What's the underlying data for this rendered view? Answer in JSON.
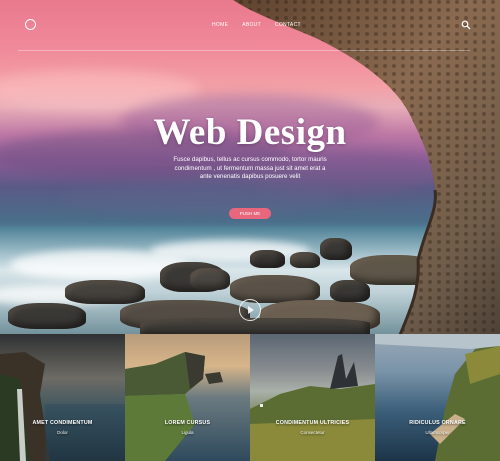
{
  "header": {
    "logo_icon": "circle-logo-icon",
    "nav": [
      {
        "label": "HOME"
      },
      {
        "label": "ABOUT"
      },
      {
        "label": "CONTACT"
      }
    ],
    "search_icon": "search-icon"
  },
  "hero": {
    "title": "Web Design",
    "subtitle": "Fusce dapibus, tellus ac cursus commodo, tortor mauris condimentum , ut fermentum massa just sit amet erat a ante venenatis dapibus posuere velit",
    "button_label": "PUSH ME",
    "play_icon": "play-icon"
  },
  "tiles": [
    {
      "title": "AMET CONDIMENTUM",
      "subtitle": "Dolor"
    },
    {
      "title": "LOREM CURSUS",
      "subtitle": "Ligula"
    },
    {
      "title": "CONDIMENTUM ULTRICIES",
      "subtitle": "Consectetur"
    },
    {
      "title": "RIDICULUS ORNARE",
      "subtitle": "Ullamcorper"
    }
  ],
  "colors": {
    "accent": "#e8677d",
    "sky_top": "#e9798c",
    "sea": "#4c7f95"
  }
}
